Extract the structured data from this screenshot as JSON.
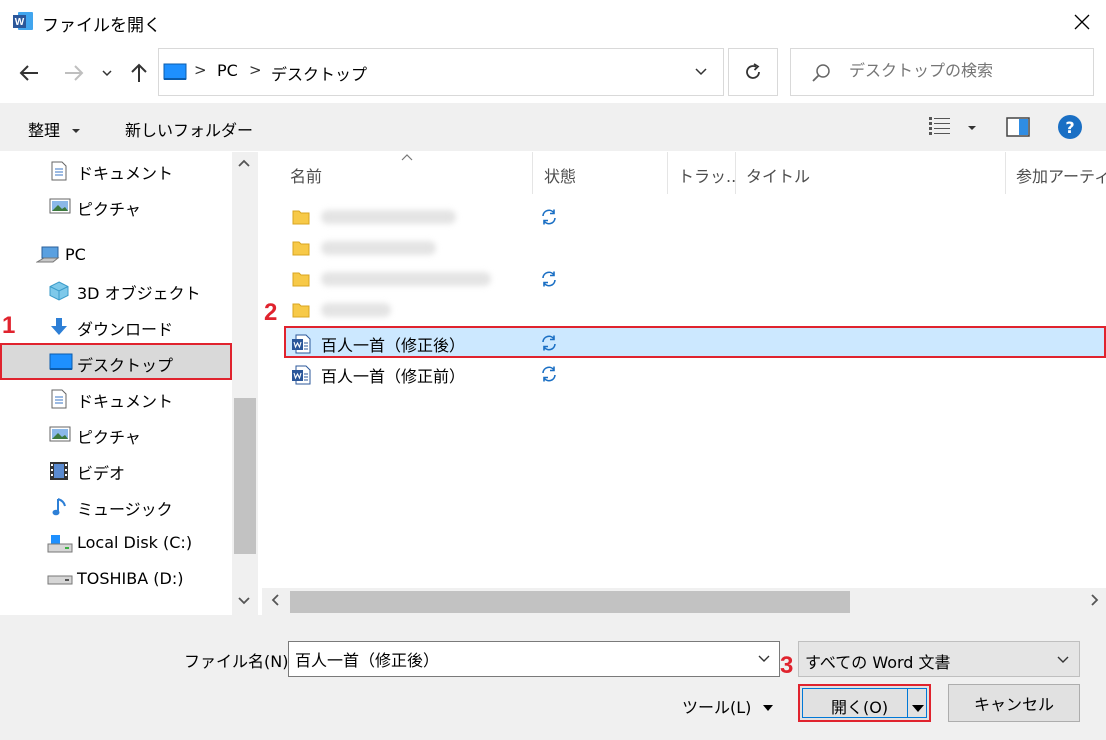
{
  "window": {
    "title": "ファイルを開く",
    "app_icon_letter": "W"
  },
  "address": {
    "crumbs": [
      "PC",
      "デスクトップ"
    ],
    "separator": ">"
  },
  "search": {
    "placeholder": "デスクトップの検索"
  },
  "commandbar": {
    "organize_label": "整理",
    "new_folder_label": "新しいフォルダー"
  },
  "sidebar": {
    "items": [
      {
        "label": "ドキュメント",
        "icon": "document-icon"
      },
      {
        "label": "ピクチャ",
        "icon": "picture-icon"
      },
      {
        "label": "PC",
        "icon": "pc-icon"
      },
      {
        "label": "3D オブジェクト",
        "icon": "cube-icon"
      },
      {
        "label": "ダウンロード",
        "icon": "download-icon"
      },
      {
        "label": "デスクトップ",
        "icon": "desktop-icon",
        "selected": true
      },
      {
        "label": "ドキュメント",
        "icon": "document-icon"
      },
      {
        "label": "ピクチャ",
        "icon": "picture-icon"
      },
      {
        "label": "ビデオ",
        "icon": "video-icon"
      },
      {
        "label": "ミュージック",
        "icon": "music-icon"
      },
      {
        "label": "Local Disk (C:)",
        "icon": "disk-icon"
      },
      {
        "label": "TOSHIBA (D:)",
        "icon": "usb-drive-icon"
      }
    ]
  },
  "filelist": {
    "columns": [
      "名前",
      "状態",
      "トラッ...",
      "タイトル",
      "参加アーティスト"
    ],
    "files": [
      {
        "name": "百人一首（修正後）",
        "selected": true
      },
      {
        "name": "百人一首（修正前）",
        "selected": false
      }
    ]
  },
  "bottom": {
    "filename_label": "ファイル名(N):",
    "filename_value": "百人一首（修正後）",
    "filetype_value": "すべての Word 文書",
    "tools_label": "ツール(L)",
    "open_label": "開く(O)",
    "cancel_label": "キャンセル"
  },
  "annotations": {
    "step1": "1",
    "step2": "2",
    "step3": "3"
  },
  "colors": {
    "highlight_red": "#e0232e",
    "selection_blue": "#cce8ff",
    "accent_blue": "#1a6fc4",
    "word_blue": "#2b579a"
  }
}
